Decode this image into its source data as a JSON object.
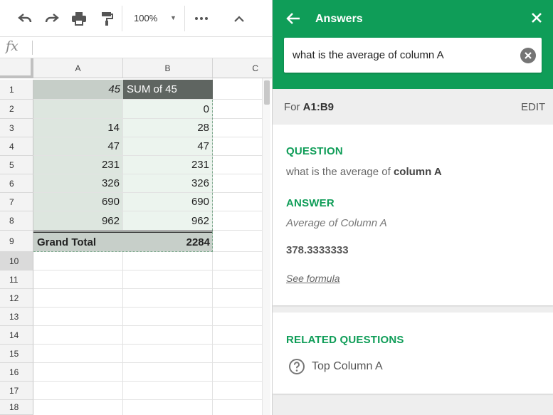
{
  "toolbar": {
    "zoom": "100%",
    "icons": [
      "undo-icon",
      "redo-icon",
      "print-icon",
      "paint-format-icon",
      "more-icon",
      "collapse-icon"
    ]
  },
  "formula_bar": {
    "label": "fx",
    "value": ""
  },
  "grid": {
    "columns": [
      "A",
      "B",
      "C"
    ],
    "rows": [
      "1",
      "2",
      "3",
      "4",
      "5",
      "6",
      "7",
      "8",
      "9",
      "10",
      "11",
      "12",
      "13",
      "14",
      "15",
      "16",
      "17",
      "18"
    ],
    "selected_row": "10",
    "cells": [
      [
        "45",
        "SUM of 45"
      ],
      [
        "",
        "0"
      ],
      [
        "14",
        "28"
      ],
      [
        "47",
        "47"
      ],
      [
        "231",
        "231"
      ],
      [
        "326",
        "326"
      ],
      [
        "690",
        "690"
      ],
      [
        "962",
        "962"
      ],
      [
        "Grand Total",
        "2284"
      ]
    ]
  },
  "panel": {
    "title": "Answers",
    "query": "what is the average of column A",
    "range_prefix": "For ",
    "range": "A1:B9",
    "edit_label": "EDIT",
    "question_label": "QUESTION",
    "question_prefix": "what is the average of ",
    "question_bold": "column A",
    "answer_label": "ANSWER",
    "answer_desc": "Average of Column A",
    "answer_value": "378.3333333",
    "formula_link": "See formula",
    "related_label": "RELATED QUESTIONS",
    "related": [
      "Top Column A"
    ],
    "accent": "#0f9d58"
  }
}
